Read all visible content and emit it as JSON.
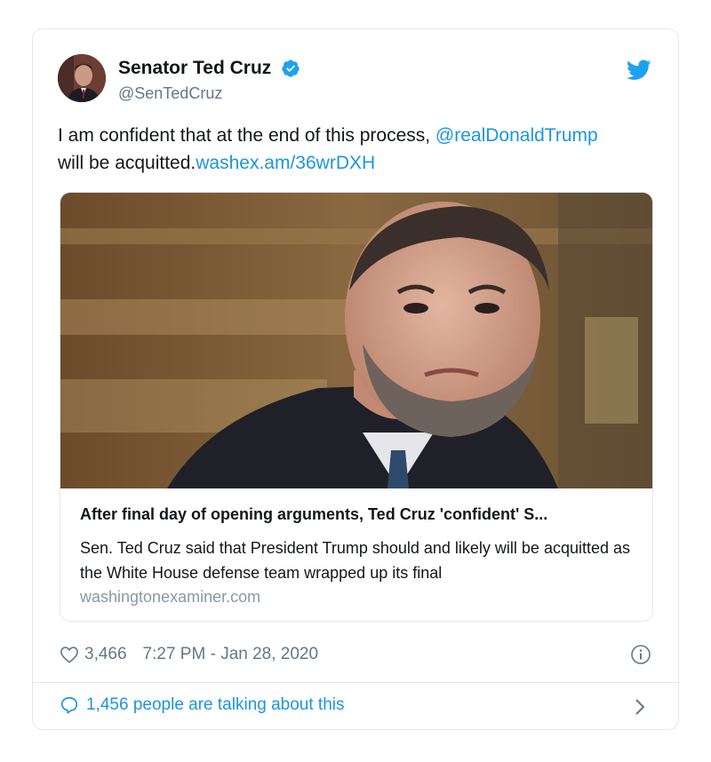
{
  "author": {
    "name": "Senator Ted Cruz",
    "handle": "@SenTedCruz",
    "verified": true
  },
  "tweet": {
    "text_part1": "I am confident that at the end of this process, ",
    "mention": "@realDonaldTrump",
    "text_part2": " will be acquitted.",
    "link": "washex.am/36wrDXH"
  },
  "link_card": {
    "title": "After final day of opening arguments, Ted Cruz 'confident' S...",
    "description": "Sen. Ted Cruz said that President Trump should and likely will be acquitted as the White House defense team wrapped up its final",
    "domain": "washingtonexaminer.com"
  },
  "meta": {
    "likes": "3,466",
    "timestamp": "7:27 PM - Jan 28, 2020"
  },
  "footer": {
    "talking": "1,456 people are talking about this"
  },
  "icons": {
    "verified": "verified-badge-icon",
    "bird": "twitter-bird-icon",
    "heart": "heart-icon",
    "info": "info-icon",
    "bubble": "comment-bubble-icon",
    "chevron": "chevron-right-icon"
  },
  "colors": {
    "link": "#1b95e0",
    "muted": "#657786",
    "border": "#e1e8ed"
  }
}
